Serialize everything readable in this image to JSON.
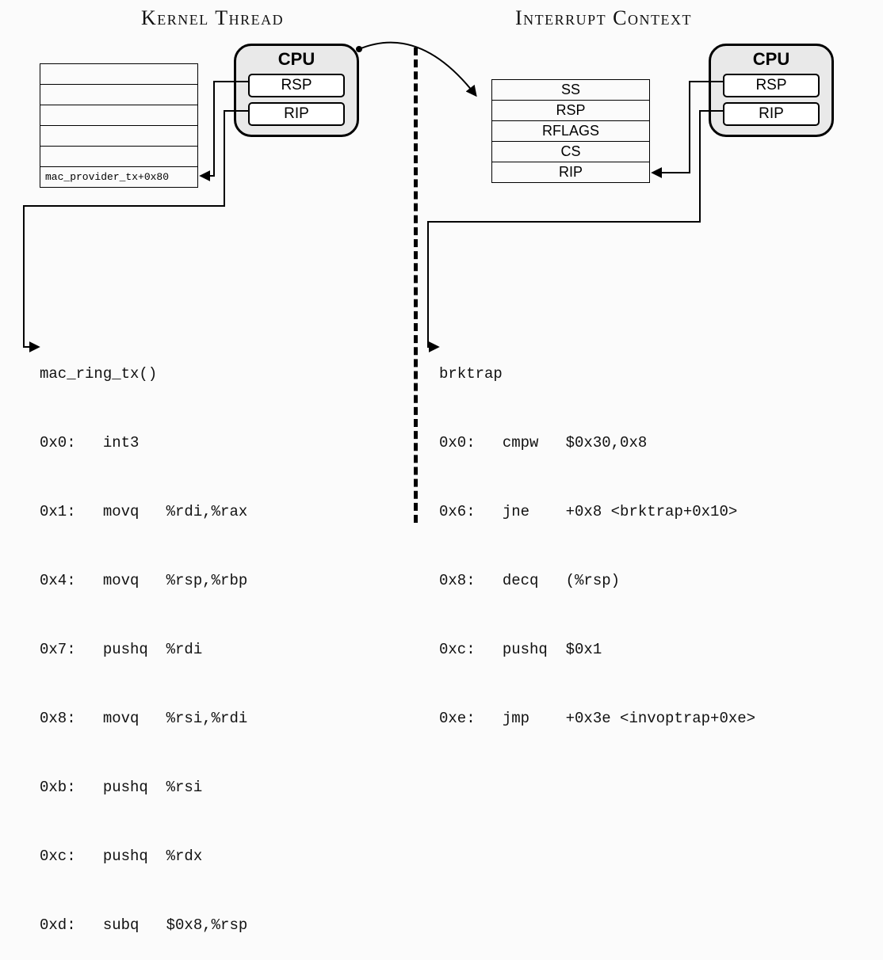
{
  "titles": {
    "left": "Kernel Thread",
    "right": "Interrupt Context"
  },
  "cpu1": {
    "title": "CPU",
    "reg1": "RSP",
    "reg2": "RIP"
  },
  "cpu2": {
    "title": "CPU",
    "reg1": "RSP",
    "reg2": "RIP"
  },
  "stack_left": {
    "rows": [
      "",
      "",
      "",
      "",
      "",
      "mac_provider_tx+0x80"
    ]
  },
  "stack_right": {
    "rows": [
      "SS",
      "RSP",
      "RFLAGS",
      "CS",
      "RIP"
    ]
  },
  "code_left": {
    "fn": "mac_ring_tx()",
    "lines": [
      "0x0:   int3",
      "0x1:   movq   %rdi,%rax",
      "0x4:   movq   %rsp,%rbp",
      "0x7:   pushq  %rdi",
      "0x8:   movq   %rsi,%rdi",
      "0xb:   pushq  %rsi",
      "0xc:   pushq  %rdx",
      "0xd:   subq   $0x8,%rsp"
    ]
  },
  "code_right": {
    "fn": "brktrap",
    "lines": [
      "0x0:   cmpw   $0x30,0x8",
      "0x6:   jne    +0x8 <brktrap+0x10>",
      "0x8:   decq   (%rsp)",
      "0xc:   pushq  $0x1",
      "0xe:   jmp    +0x3e <invoptrap+0xe>"
    ]
  }
}
